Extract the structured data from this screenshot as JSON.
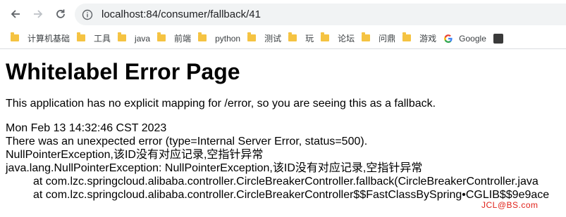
{
  "browser": {
    "url": "localhost:84/consumer/fallback/41",
    "bookmarks": [
      {
        "label": "计算机基础",
        "icon": "folder-icon"
      },
      {
        "label": "工具",
        "icon": "folder-icon"
      },
      {
        "label": "java",
        "icon": "folder-icon"
      },
      {
        "label": "前端",
        "icon": "folder-icon"
      },
      {
        "label": "python",
        "icon": "folder-icon"
      },
      {
        "label": "测试",
        "icon": "folder-icon"
      },
      {
        "label": "玩",
        "icon": "folder-icon"
      },
      {
        "label": "论坛",
        "icon": "folder-icon"
      },
      {
        "label": "问鼎",
        "icon": "folder-icon"
      },
      {
        "label": "游戏",
        "icon": "folder-icon"
      },
      {
        "label": "Google",
        "icon": "google-icon"
      }
    ]
  },
  "error_page": {
    "title": "Whitelabel Error Page",
    "message": "This application has no explicit mapping for /error, so you are seeing this as a fallback.",
    "timestamp": "Mon Feb 13 14:32:46 CST 2023",
    "summary": "There was an unexpected error (type=Internal Server Error, status=500).",
    "exception_message": "NullPointerException,该ID没有对应记录,空指针异常",
    "stack_trace": [
      "java.lang.NullPointerException: NullPointerException,该ID没有对应记录,空指针异常",
      "at com.lzc.springcloud.alibaba.controller.CircleBreakerController.fallback(CircleBreakerController.java",
      "at com.lzc.springcloud.alibaba.controller.CircleBreakerController$$FastClassBySpring•CGLIB$$9e9ace"
    ]
  },
  "watermark": "JCL@BS.com"
}
